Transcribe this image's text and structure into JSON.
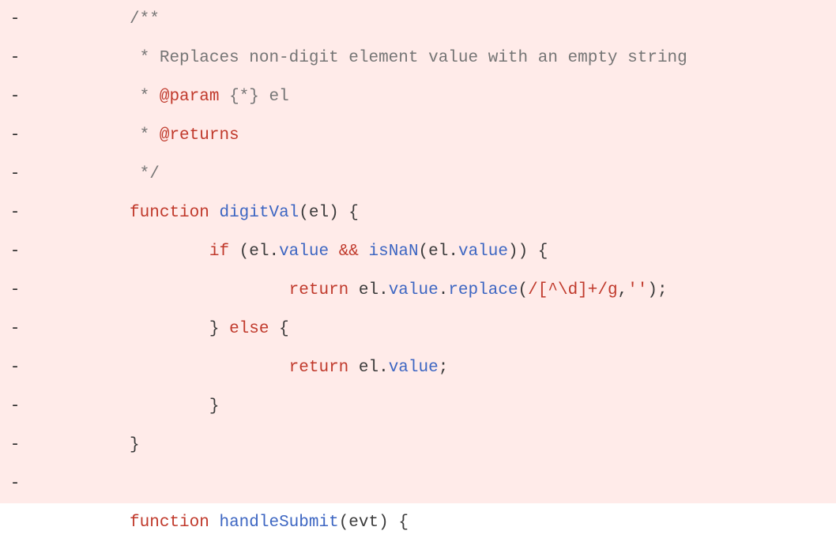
{
  "diff": {
    "lines": [
      {
        "type": "deletion",
        "marker": "-",
        "indent": "          ",
        "tokens": [
          {
            "t": "/**",
            "c": "c-cmt"
          }
        ]
      },
      {
        "type": "deletion",
        "marker": "-",
        "indent": "          ",
        "tokens": [
          {
            "t": " * Replaces non-digit element value with an empty string",
            "c": "c-cmt"
          }
        ]
      },
      {
        "type": "deletion",
        "marker": "-",
        "indent": "          ",
        "tokens": [
          {
            "t": " * ",
            "c": "c-cmt"
          },
          {
            "t": "@param",
            "c": "c-tag"
          },
          {
            "t": " {*} el",
            "c": "c-cmt"
          }
        ]
      },
      {
        "type": "deletion",
        "marker": "-",
        "indent": "          ",
        "tokens": [
          {
            "t": " * ",
            "c": "c-cmt"
          },
          {
            "t": "@returns",
            "c": "c-tag"
          }
        ]
      },
      {
        "type": "deletion",
        "marker": "-",
        "indent": "          ",
        "tokens": [
          {
            "t": " */",
            "c": "c-cmt"
          }
        ]
      },
      {
        "type": "deletion",
        "marker": "-",
        "indent": "          ",
        "tokens": [
          {
            "t": "function",
            "c": "c-kw"
          },
          {
            "t": " ",
            "c": ""
          },
          {
            "t": "digitVal",
            "c": "c-fn"
          },
          {
            "t": "(el) {",
            "c": "c-punc"
          }
        ]
      },
      {
        "type": "deletion",
        "marker": "-",
        "indent": "                  ",
        "tokens": [
          {
            "t": "if",
            "c": "c-kw"
          },
          {
            "t": " (el.",
            "c": "c-punc"
          },
          {
            "t": "value",
            "c": "c-prop"
          },
          {
            "t": " ",
            "c": ""
          },
          {
            "t": "&&",
            "c": "c-op"
          },
          {
            "t": " ",
            "c": ""
          },
          {
            "t": "isNaN",
            "c": "c-fn"
          },
          {
            "t": "(el.",
            "c": "c-punc"
          },
          {
            "t": "value",
            "c": "c-prop"
          },
          {
            "t": ")) {",
            "c": "c-punc"
          }
        ]
      },
      {
        "type": "deletion",
        "marker": "-",
        "indent": "                          ",
        "tokens": [
          {
            "t": "return",
            "c": "c-kw"
          },
          {
            "t": " el.",
            "c": "c-punc"
          },
          {
            "t": "value",
            "c": "c-prop"
          },
          {
            "t": ".",
            "c": "c-punc"
          },
          {
            "t": "replace",
            "c": "c-fn"
          },
          {
            "t": "(",
            "c": "c-punc"
          },
          {
            "t": "/[^\\d]+/g",
            "c": "c-regex"
          },
          {
            "t": ",",
            "c": "c-punc"
          },
          {
            "t": "''",
            "c": "c-str"
          },
          {
            "t": ");",
            "c": "c-punc"
          }
        ]
      },
      {
        "type": "deletion",
        "marker": "-",
        "indent": "                  ",
        "tokens": [
          {
            "t": "} ",
            "c": "c-punc"
          },
          {
            "t": "else",
            "c": "c-kw"
          },
          {
            "t": " {",
            "c": "c-punc"
          }
        ]
      },
      {
        "type": "deletion",
        "marker": "-",
        "indent": "                          ",
        "tokens": [
          {
            "t": "return",
            "c": "c-kw"
          },
          {
            "t": " el.",
            "c": "c-punc"
          },
          {
            "t": "value",
            "c": "c-prop"
          },
          {
            "t": ";",
            "c": "c-punc"
          }
        ]
      },
      {
        "type": "deletion",
        "marker": "-",
        "indent": "                  ",
        "tokens": [
          {
            "t": "}",
            "c": "c-punc"
          }
        ]
      },
      {
        "type": "deletion",
        "marker": "-",
        "indent": "          ",
        "tokens": [
          {
            "t": "}",
            "c": "c-punc"
          }
        ]
      },
      {
        "type": "deletion",
        "marker": "-",
        "indent": "",
        "tokens": []
      },
      {
        "type": "unchanged",
        "marker": "",
        "indent": "          ",
        "tokens": [
          {
            "t": "function",
            "c": "c-kw"
          },
          {
            "t": " ",
            "c": ""
          },
          {
            "t": "handleSubmit",
            "c": "c-fn"
          },
          {
            "t": "(evt) {",
            "c": "c-punc"
          }
        ]
      }
    ]
  }
}
